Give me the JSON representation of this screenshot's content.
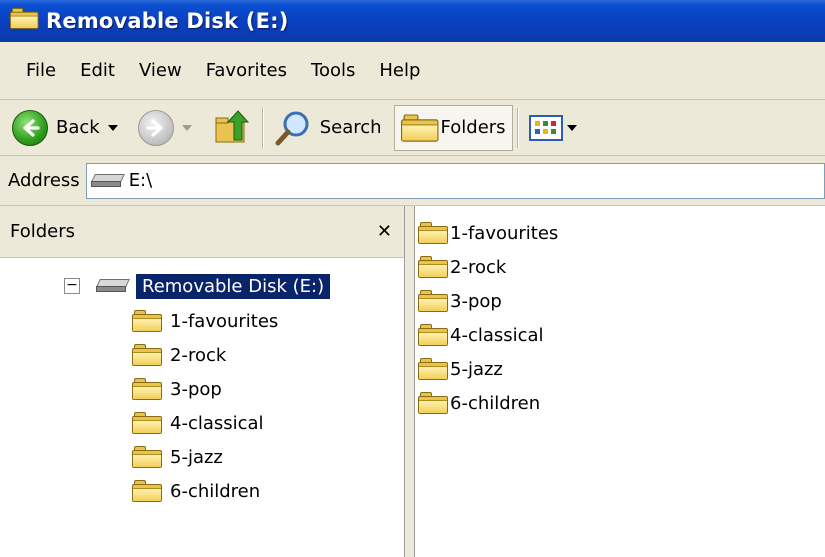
{
  "window": {
    "title": "Removable Disk (E:)"
  },
  "menu": [
    "File",
    "Edit",
    "View",
    "Favorites",
    "Tools",
    "Help"
  ],
  "toolbar": {
    "back_label": "Back",
    "search_label": "Search",
    "folders_label": "Folders"
  },
  "address": {
    "label": "Address",
    "value": "E:\\"
  },
  "folders_pane": {
    "title": "Folders",
    "close_glyph": "✕",
    "expander_glyph": "−",
    "root_label": "Removable Disk (E:)",
    "items": [
      "1-favourites",
      "2-rock",
      "3-pop",
      "4-classical",
      "5-jazz",
      "6-children"
    ]
  },
  "list_pane": {
    "items": [
      "1-favourites",
      "2-rock",
      "3-pop",
      "4-classical",
      "5-jazz",
      "6-children"
    ]
  }
}
